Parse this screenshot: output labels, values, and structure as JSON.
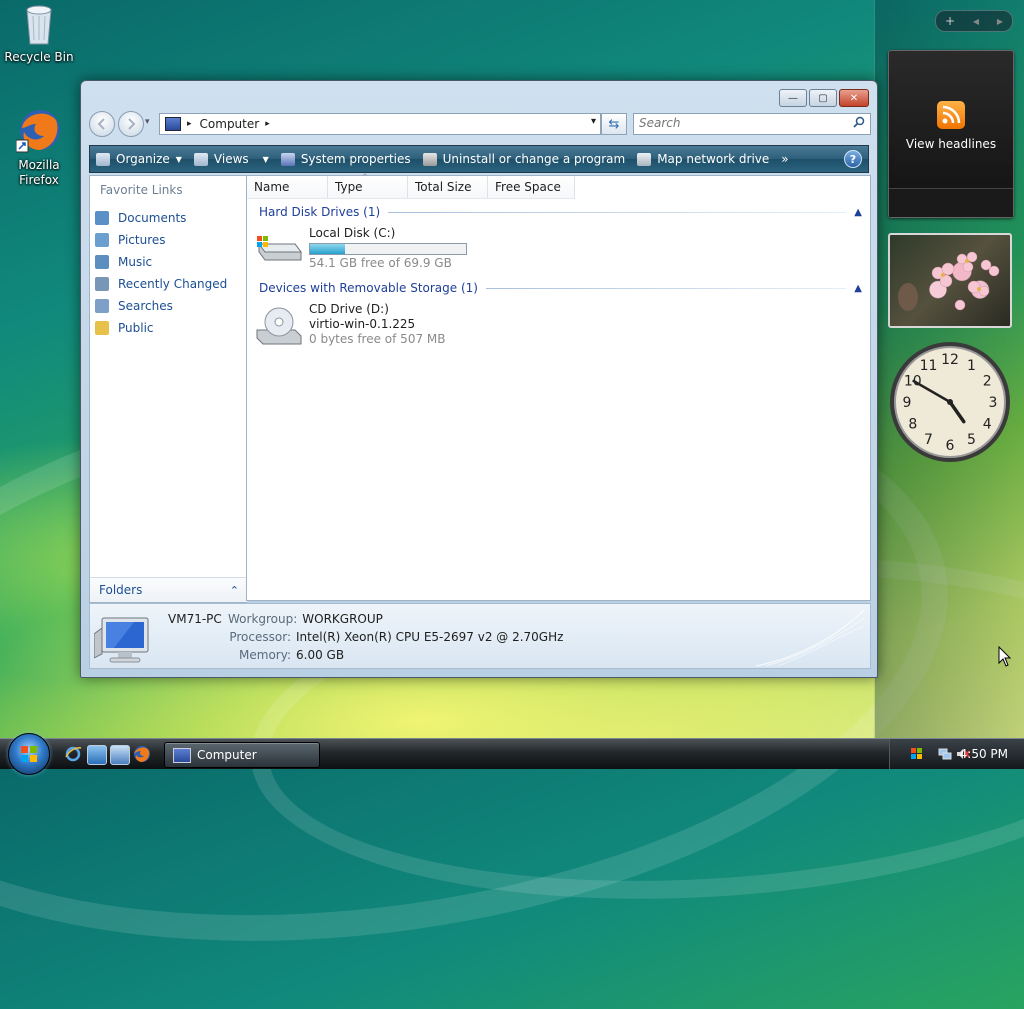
{
  "desktop": {
    "icons": [
      {
        "label": "Recycle Bin",
        "icon": "recycle-bin-icon"
      },
      {
        "label": "Mozilla Firefox",
        "icon": "firefox-icon"
      }
    ]
  },
  "sidebar": {
    "controls": {
      "add": "+",
      "prev": "◀",
      "next": "▶"
    },
    "feed_gadget": {
      "label": "View headlines",
      "icon": "rss-icon"
    },
    "clock_numerals": [
      "12",
      "1",
      "2",
      "3",
      "4",
      "5",
      "6",
      "7",
      "8",
      "9",
      "10",
      "11"
    ],
    "clock_time": {
      "hour": 4,
      "minute": 50
    }
  },
  "window": {
    "title_buttons": {
      "minimize": "—",
      "maximize": "▢",
      "close": "✕"
    },
    "address": {
      "crumb": "Computer",
      "arrow": "▸",
      "dropdown": "▾"
    },
    "search": {
      "placeholder": "Search"
    },
    "toolbar": {
      "organize": "Organize",
      "views": "Views",
      "system_properties": "System properties",
      "uninstall": "Uninstall or change a program",
      "map_drive": "Map network drive",
      "more": "»",
      "help": "?"
    },
    "favorite_links": {
      "title": "Favorite Links",
      "items": [
        {
          "label": "Documents",
          "icon": "documents-icon",
          "color": "#5b8fc7"
        },
        {
          "label": "Pictures",
          "icon": "pictures-icon",
          "color": "#6a9fcf"
        },
        {
          "label": "Music",
          "icon": "music-icon",
          "color": "#5d8ec0"
        },
        {
          "label": "Recently Changed",
          "icon": "recently-changed-icon",
          "color": "#7896b8"
        },
        {
          "label": "Searches",
          "icon": "searches-icon",
          "color": "#7ea0c8"
        },
        {
          "label": "Public",
          "icon": "public-folder-icon",
          "color": "#e8c14a"
        }
      ]
    },
    "folders_label": "Folders",
    "columns": [
      "Name",
      "Type",
      "Total Size",
      "Free Space"
    ],
    "groups": [
      {
        "title": "Hard Disk Drives (1)"
      },
      {
        "title": "Devices with Removable Storage (1)"
      }
    ],
    "drives": {
      "local": {
        "name": "Local Disk (C:)",
        "free_text": "54.1 GB free of 69.9 GB",
        "used_fraction": 0.226
      },
      "cd": {
        "name": "CD Drive (D:)",
        "label": "virtio-win-0.1.225",
        "free_text": "0 bytes free of 507 MB"
      }
    },
    "details": {
      "pc_name": "VM71-PC",
      "workgroup_key": "Workgroup:",
      "workgroup_val": "WORKGROUP",
      "processor_key": "Processor:",
      "processor_val": "Intel(R) Xeon(R) CPU E5-2697 v2 @ 2.70GHz",
      "memory_key": "Memory:",
      "memory_val": "6.00 GB"
    }
  },
  "taskbar": {
    "task": "Computer",
    "clock": "4:50 PM"
  },
  "colors": {
    "link": "#1c4f93",
    "group_header": "#1e3f9a",
    "toolbar": "#2d5f7a"
  }
}
